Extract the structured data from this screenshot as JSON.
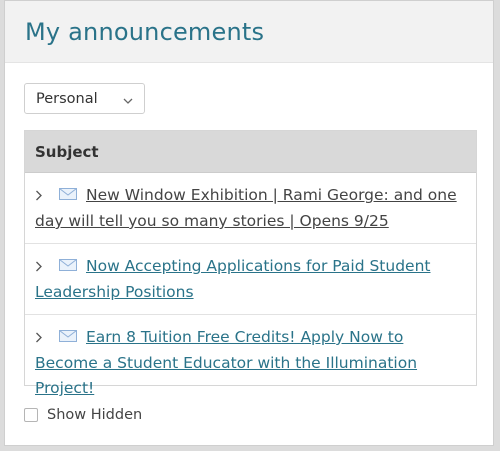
{
  "panel": {
    "title": "My announcements"
  },
  "filter": {
    "selected": "Personal"
  },
  "table": {
    "header": "Subject",
    "rows": [
      {
        "subject": "New Window Exhibition | Rami George: and one day will tell you so many stories | Opens 9/25",
        "visited": true
      },
      {
        "subject": "Now Accepting Applications for Paid Student Leadership Positions",
        "visited": false
      },
      {
        "subject": "Earn 8 Tuition Free Credits! Apply Now to Become a Student Educator with the Illumination Project!",
        "visited": false
      }
    ]
  },
  "footer": {
    "show_hidden_label": "Show Hidden"
  },
  "icons": {
    "expand": "chevron-right-icon",
    "message": "mail-icon",
    "dropdown": "chevron-down-icon"
  },
  "colors": {
    "accent": "#2a7389",
    "header_bg": "#f2f2f2",
    "table_head_bg": "#d9d9d9"
  }
}
